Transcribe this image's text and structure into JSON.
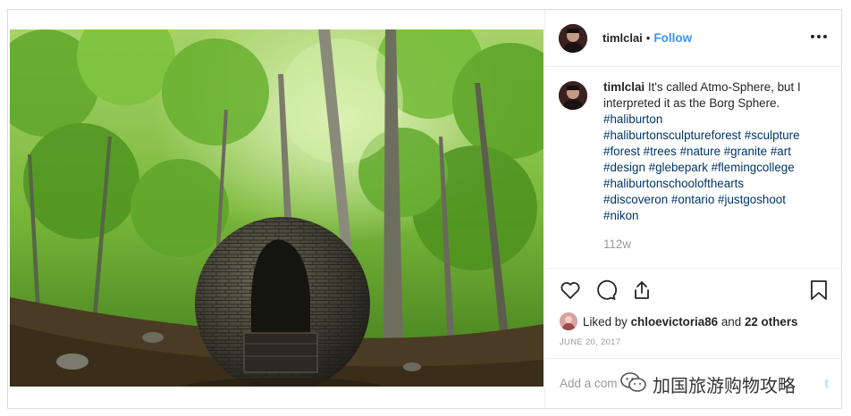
{
  "post": {
    "username": "timlclai",
    "separator": "•",
    "follow_label": "Follow",
    "more_icon": "more-options-icon",
    "caption": {
      "username": "timlclai",
      "text": "It's called Atmo-Sphere, but I interpreted it as the Borg Sphere.",
      "hashtags": [
        "#haliburton",
        "#haliburtonsculptureforest #sculpture",
        "#forest #trees #nature #granite #art",
        "#design #glebepark #flemingcollege",
        "#haliburtonschoolofthearts",
        "#discoveron #ontario #justgoshoot",
        "#nikon"
      ],
      "time_ago": "112w"
    },
    "actions": {
      "like_icon": "heart-icon",
      "comment_icon": "comment-bubble-icon",
      "share_icon": "share-icon",
      "save_icon": "bookmark-icon"
    },
    "likes": {
      "prefix": "Liked by",
      "user": "chloevictoria86",
      "middle": "and",
      "others": "22 others"
    },
    "date": "JUNE 20, 2017",
    "add_comment_placeholder": "Add a comme",
    "post_button": "t"
  },
  "watermark": {
    "icon": "wechat-icon",
    "text": "加国旅游购物攻略"
  },
  "colors": {
    "link_blue": "#3897f0",
    "hashtag_blue": "#003569",
    "muted_gray": "#999999",
    "border": "#dbdbdb"
  }
}
